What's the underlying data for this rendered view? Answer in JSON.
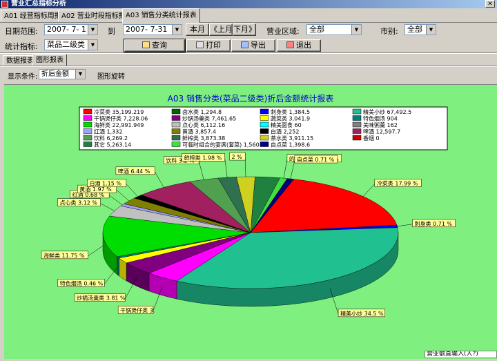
{
  "window": {
    "title": "营业汇总指标分析"
  },
  "tabs": [
    {
      "label": "A01 经营指标周报表"
    },
    {
      "label": "A02 营业时段指标报表"
    },
    {
      "label": "A03 销售分类统计报表"
    }
  ],
  "filters": {
    "date_range_label": "日期范围:",
    "date_from": "2007- 7- 1",
    "to_label": "到",
    "date_to": "2007- 7-31",
    "this_month": "本月",
    "prev_month": "《上月",
    "next_month": "下月》",
    "area_label": "营业区域:",
    "area_value": "全部",
    "city_label": "市别:",
    "city_value": "全部",
    "stat_label": "统计指标:",
    "stat_value": "菜品二级类",
    "query": "查询",
    "print": "打印",
    "export": "导出",
    "exit": "退出"
  },
  "subtabs": [
    {
      "label": "数据报表"
    },
    {
      "label": "图形报表"
    }
  ],
  "display": {
    "cond_label": "显示条件:",
    "cond_value": "折后金额",
    "rotate_label": "图形旋转"
  },
  "status_text": "营业额直输入(人?)",
  "colors": {
    "chart_bg": "#7ff07f"
  },
  "chart_data": {
    "type": "pie",
    "title": "A03 销售分类(菜品二级类)折后金额统计报表",
    "legend_position": "top",
    "legend": [
      {
        "text": "冷菜类 35,199.219",
        "color": "#ff0000"
      },
      {
        "text": "卤水类 1,294.8",
        "color": "#006400"
      },
      {
        "text": "刺身类 1,384.5",
        "color": "#0000ff"
      },
      {
        "text": "精美小炒 67,492.5",
        "color": "#20c090"
      },
      {
        "text": "干锅煲仔类 7,228.06",
        "color": "#ff00ff"
      },
      {
        "text": "炒锅汤羹类 7,461.65",
        "color": "#800080"
      },
      {
        "text": "蔬菜类 3,041.9",
        "color": "#ffff00"
      },
      {
        "text": "特色烟汤 904",
        "color": "#008080"
      },
      {
        "text": "海鲜类 22,991.949",
        "color": "#00dd00"
      },
      {
        "text": "点心类 6,112.16",
        "color": "#c0c0c0"
      },
      {
        "text": "精美面食 60",
        "color": "#00ffff"
      },
      {
        "text": "美味粥羹 162",
        "color": "#808080"
      },
      {
        "text": "红酒 1,332",
        "color": "#a0a0ff"
      },
      {
        "text": "黄酒 3,857.4",
        "color": "#808000"
      },
      {
        "text": "白酒 2,252",
        "color": "#000000"
      },
      {
        "text": "啤酒 12,597.7",
        "color": "#a02060"
      },
      {
        "text": "饮料 6,269.2",
        "color": "#50a050"
      },
      {
        "text": "鲜榨类 3,873.38",
        "color": "#2e7050"
      },
      {
        "text": "茶水类 3,911.15",
        "color": "#d0d020"
      },
      {
        "text": "香烟 0",
        "color": "#cc0000"
      },
      {
        "text": "其它 5,263.14",
        "color": "#208040"
      },
      {
        "text": "可临时组合的宴席(套菜) 1,560",
        "color": "#40e040"
      },
      {
        "text": "自点菜 1,398.6",
        "color": "#000080"
      }
    ],
    "slices": [
      {
        "name": "冷菜类",
        "value": 35199.219,
        "label": "冷菜类 17.99 %"
      },
      {
        "name": "刺身类",
        "value": 1384.5,
        "label": "刺身类 0.71 %"
      },
      {
        "name": "精美小炒",
        "value": 67492.5,
        "label": "精美小炒 34.5 %"
      },
      {
        "name": "干锅煲仔类",
        "value": 7228.06,
        "label": "干锅煲仔类 3."
      },
      {
        "name": "炒锅汤羹类",
        "value": 7461.65,
        "label": "炒锅汤羹类 3.81 %"
      },
      {
        "name": "蔬菜类",
        "value": 3041.9,
        "label": ""
      },
      {
        "name": "特色烟汤",
        "value": 904,
        "label": "特色烟汤 0.46 %"
      },
      {
        "name": "海鲜类",
        "value": 22991.949,
        "label": "海鲜类 11.75 %"
      },
      {
        "name": "点心类",
        "value": 6112.16,
        "label": "点心类 3.12 %"
      },
      {
        "name": "红酒",
        "value": 1332,
        "label": "红酒 0.68 %"
      },
      {
        "name": "黄酒",
        "value": 3857.4,
        "label": "黄酒 1.97 %"
      },
      {
        "name": "白酒",
        "value": 2252,
        "label": "白酒 1.15 %"
      },
      {
        "name": "啤酒",
        "value": 12597.7,
        "label": "啤酒 6.44 %"
      },
      {
        "name": "饮料",
        "value": 6269.2,
        "label": "饮料 3.2 %"
      },
      {
        "name": "鲜榨类",
        "value": 3873.38,
        "label": "鲜榨类 1.98 %"
      },
      {
        "name": "茶水类",
        "value": 3911.15,
        "label": "2 %"
      },
      {
        "name": "其它",
        "value": 5263.14,
        "label": ""
      },
      {
        "name": "可临时组合的宴席(套菜)",
        "value": 1560,
        "label": "的宴席(套菜) 0.8 %"
      },
      {
        "name": "自点菜",
        "value": 1398.6,
        "label": "自点菜 0.71 %"
      }
    ]
  }
}
